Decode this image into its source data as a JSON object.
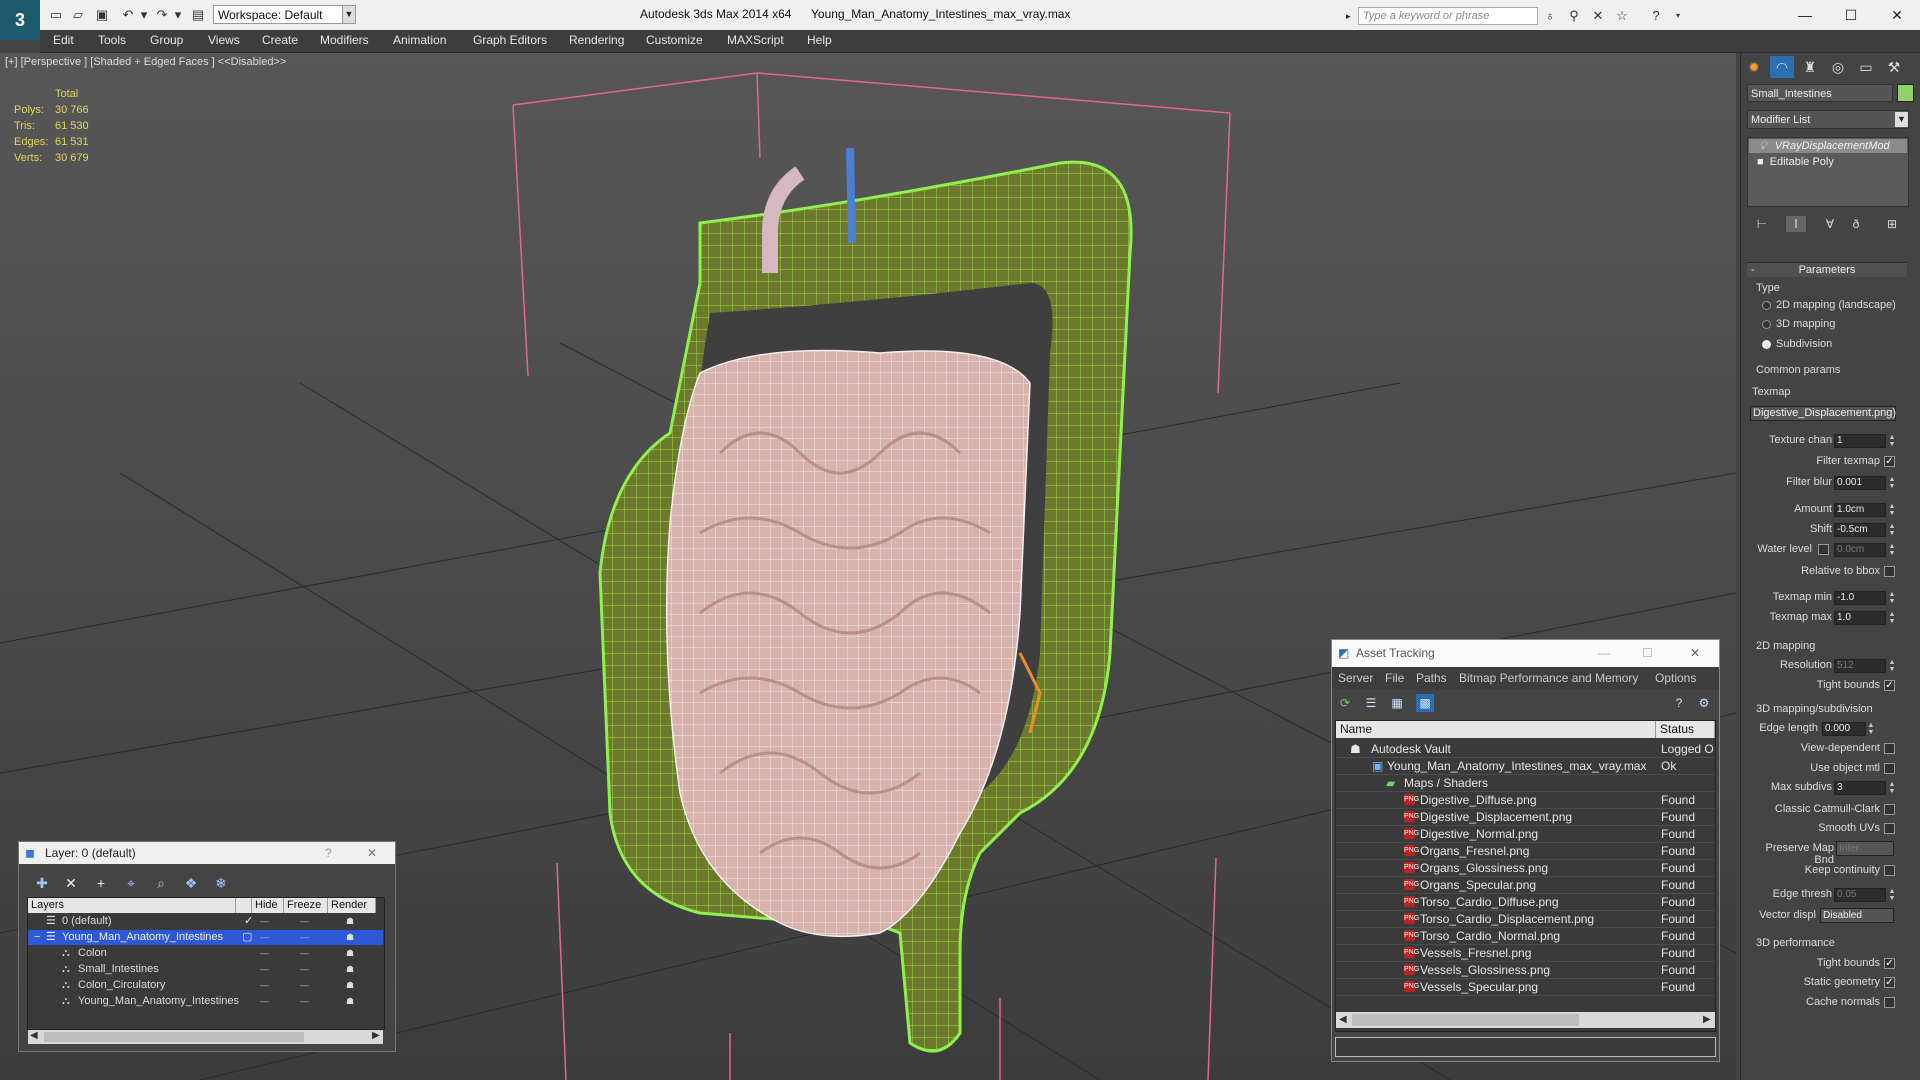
{
  "titlebar": {
    "app_logo": "3",
    "workspace": "Workspace: Default",
    "app_title": "Autodesk 3ds Max  2014 x64",
    "file_title": "Young_Man_Anatomy_Intestines_max_vray.max",
    "search_placeholder": "Type a keyword or phrase"
  },
  "menu": [
    "Edit",
    "Tools",
    "Group",
    "Views",
    "Create",
    "Modifiers",
    "Animation",
    "Graph Editors",
    "Rendering",
    "Customize",
    "MAXScript",
    "Help"
  ],
  "viewport": {
    "label": "[+] [Perspective ] [Shaded + Edged Faces ]  <<Disabled>>",
    "stats_header": "Total",
    "stats": [
      {
        "label": "Polys:",
        "value": "30 766"
      },
      {
        "label": "Tris:",
        "value": "61 530"
      },
      {
        "label": "Edges:",
        "value": "61 531"
      },
      {
        "label": "Verts:",
        "value": "30 679"
      }
    ]
  },
  "command_panel": {
    "object_name": "Small_Intestines",
    "object_color": "#8fd36a",
    "modifier_list": "Modifier List",
    "stack": [
      "VRayDisplacementMod",
      "Editable Poly"
    ],
    "rollout_title": "Parameters",
    "type_group": "Type",
    "type_options": [
      "2D mapping (landscape)",
      "3D mapping",
      "Subdivision"
    ],
    "type_selected": "Subdivision",
    "common_group": "Common params",
    "texmap_label": "Texmap",
    "texmap_value": "Digestive_Displacement.png)",
    "texture_chan_label": "Texture chan",
    "texture_chan": "1",
    "filter_texmap_label": "Filter texmap",
    "filter_blur_label": "Filter blur",
    "filter_blur": "0.001",
    "amount_label": "Amount",
    "amount": "1.0cm",
    "shift_label": "Shift",
    "shift": "-0.5cm",
    "water_level_label": "Water level",
    "water_level": "0.0cm",
    "relative_bbox_label": "Relative to bbox",
    "texmap_min_label": "Texmap min",
    "texmap_min": "-1.0",
    "texmap_max_label": "Texmap max",
    "texmap_max": "1.0",
    "mapping2d_group": "2D mapping",
    "resolution_label": "Resolution",
    "resolution": "512",
    "tight_bounds_label": "Tight bounds",
    "mapping3d_group": "3D mapping/subdivision",
    "edge_length_label": "Edge length",
    "edge_length": "0.000",
    "view_dependent_label": "View-dependent",
    "use_object_mtl_label": "Use object mtl",
    "max_subdivs_label": "Max subdivs",
    "max_subdivs": "3",
    "classic_catmull_label": "Classic Catmull-Clark",
    "smooth_uvs_label": "Smooth UVs",
    "preserve_map_label": "Preserve Map Bnd",
    "preserve_map_value": "Inter",
    "keep_continuity_label": "Keep continuity",
    "edge_thresh_label": "Edge thresh",
    "edge_thresh": "0.05",
    "vector_displ_label": "Vector displ",
    "vector_displ_value": "Disabled",
    "perf_group": "3D performance",
    "perf_tight_bounds_label": "Tight bounds",
    "static_geometry_label": "Static geometry",
    "cache_normals_label": "Cache normals"
  },
  "layer_dialog": {
    "title": "Layer: 0 (default)",
    "help": "?",
    "columns": [
      "Layers",
      "Hide",
      "Freeze",
      "Render"
    ],
    "rows": [
      {
        "name": "0 (default)"
      },
      {
        "name": "Young_Man_Anatomy_Intestines"
      },
      {
        "name": "Colon"
      },
      {
        "name": "Small_Intestines"
      },
      {
        "name": "Colon_Circulatory"
      },
      {
        "name": "Young_Man_Anatomy_Intestines"
      }
    ],
    "dash": "—"
  },
  "asset_dialog": {
    "title": "Asset Tracking",
    "menu": [
      "Server",
      "File",
      "Paths",
      "Bitmap Performance and Memory",
      "Options"
    ],
    "columns": [
      "Name",
      "Status"
    ],
    "rows": [
      {
        "name": "Autodesk Vault",
        "status": "Logged O"
      },
      {
        "name": "Young_Man_Anatomy_Intestines_max_vray.max",
        "status": "Ok"
      },
      {
        "name": "Maps / Shaders",
        "status": ""
      },
      {
        "name": "Digestive_Diffuse.png",
        "status": "Found"
      },
      {
        "name": "Digestive_Displacement.png",
        "status": "Found"
      },
      {
        "name": "Digestive_Normal.png",
        "status": "Found"
      },
      {
        "name": "Organs_Fresnel.png",
        "status": "Found"
      },
      {
        "name": "Organs_Glossiness.png",
        "status": "Found"
      },
      {
        "name": "Organs_Specular.png",
        "status": "Found"
      },
      {
        "name": "Torso_Cardio_Diffuse.png",
        "status": "Found"
      },
      {
        "name": "Torso_Cardio_Displacement.png",
        "status": "Found"
      },
      {
        "name": "Torso_Cardio_Normal.png",
        "status": "Found"
      },
      {
        "name": "Vessels_Fresnel.png",
        "status": "Found"
      },
      {
        "name": "Vessels_Glossiness.png",
        "status": "Found"
      },
      {
        "name": "Vessels_Specular.png",
        "status": "Found"
      }
    ],
    "png_icon": "PNG"
  },
  "icons": {
    "new": "new-file-icon",
    "open": "open-folder-icon",
    "save": "save-icon",
    "undo": "undo-icon",
    "redo": "redo-icon",
    "create": "create-tab-icon",
    "modify": "modify-tab-icon",
    "hierarchy": "hierarchy-tab-icon",
    "motion": "motion-tab-icon",
    "display": "display-tab-icon",
    "utilities": "utilities-tab-icon"
  }
}
